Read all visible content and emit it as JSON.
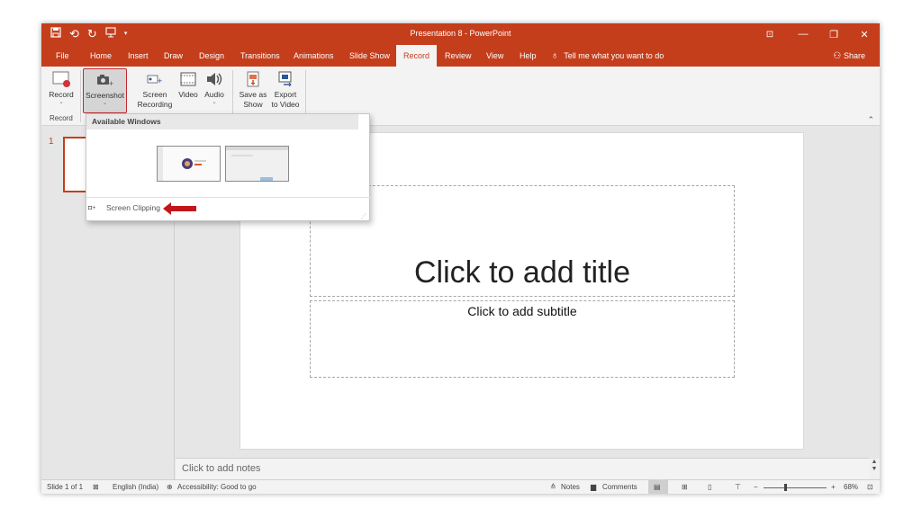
{
  "titlebar": {
    "title": "Presentation 8  -  PowerPoint",
    "qat_icons": [
      "save-icon",
      "undo-icon",
      "redo-icon",
      "present-icon",
      "customize-icon"
    ],
    "controls": {
      "ribbon_display": "⊡",
      "minimize": "—",
      "restore": "❐",
      "close": "✕"
    }
  },
  "tabs": [
    "File",
    "Home",
    "Insert",
    "Draw",
    "Design",
    "Transitions",
    "Animations",
    "Slide Show",
    "Record",
    "Review",
    "View",
    "Help"
  ],
  "active_tab": "Record",
  "tell_me": "Tell me what you want to do",
  "share": "Share",
  "ribbon": {
    "record": {
      "label": "Record",
      "caret": "⌄"
    },
    "screenshot": {
      "label": "Screenshot",
      "caret": "⌄"
    },
    "screen_recording": {
      "line1": "Screen",
      "line2": "Recording"
    },
    "video": {
      "label": "Video"
    },
    "audio": {
      "label": "Audio",
      "caret": "⌄"
    },
    "save_as_show": {
      "line1": "Save as",
      "line2": "Show"
    },
    "export_to_video": {
      "line1": "Export",
      "line2": "to Video"
    },
    "group_record": "Record"
  },
  "dropdown": {
    "header": "Available Windows",
    "screen_clipping": "Screen Clipping"
  },
  "slides": {
    "number": "1"
  },
  "slide": {
    "title_placeholder": "Click to add title",
    "subtitle_placeholder": "Click to add subtitle"
  },
  "notes_placeholder": "Click to add notes",
  "status": {
    "slide_info": "Slide 1 of 1",
    "language": "English (India)",
    "accessibility": "Accessibility: Good to go",
    "notes": "Notes",
    "comments": "Comments",
    "zoom": "68%",
    "zoom_minus": "−",
    "zoom_plus": "+"
  },
  "colors": {
    "accent": "#c43e1c",
    "highlight_border": "#c0282e",
    "arrow": "#c0161c"
  }
}
